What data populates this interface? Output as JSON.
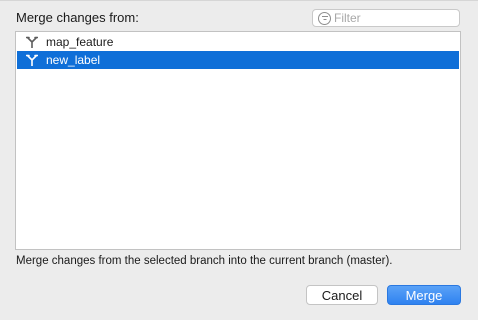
{
  "dialog": {
    "title_label": "Merge changes from:",
    "hint_text": "Merge changes from the selected branch into the current branch (master)."
  },
  "filter": {
    "placeholder": "Filter",
    "value": "",
    "icon": "filter-icon"
  },
  "branches": [
    {
      "name": "map_feature",
      "icon": "branch-icon",
      "selected": false
    },
    {
      "name": "new_label",
      "icon": "branch-icon",
      "selected": true
    }
  ],
  "buttons": {
    "cancel_label": "Cancel",
    "merge_label": "Merge"
  },
  "colors": {
    "selection": "#0f6fd8",
    "primary_button": "#2f82f0",
    "background": "#ececec"
  }
}
